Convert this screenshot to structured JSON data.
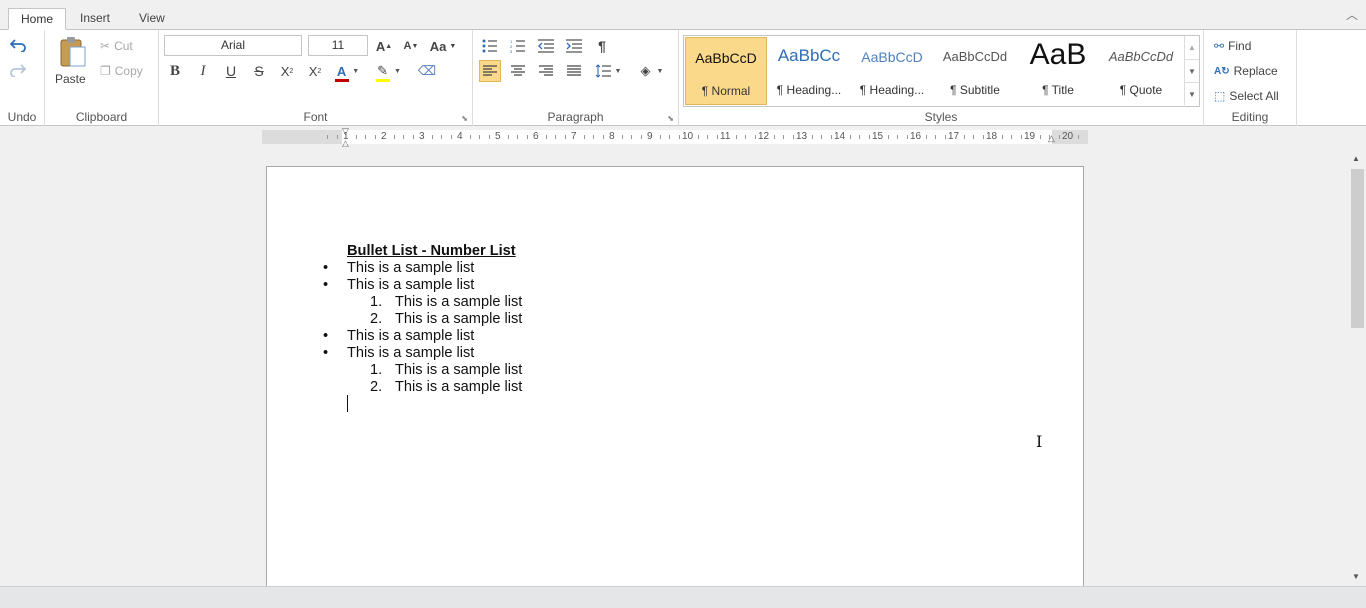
{
  "tabs": [
    "Home",
    "Insert",
    "View"
  ],
  "active_tab": "Home",
  "collapse_icon": "chevron-up-icon",
  "groups": {
    "undo": "Undo",
    "clipboard": "Clipboard",
    "font": "Font",
    "paragraph": "Paragraph",
    "styles": "Styles",
    "editing": "Editing"
  },
  "clipboard": {
    "paste": "Paste",
    "cut": "Cut",
    "copy": "Copy"
  },
  "font": {
    "name": "Arial",
    "size": "11"
  },
  "styles": [
    {
      "sample": "AaBbCcD",
      "name": "¶ Normal",
      "selected": true
    },
    {
      "sample": "AaBbCc",
      "name": "¶ Heading..."
    },
    {
      "sample": "AaBbCcD",
      "name": "¶ Heading..."
    },
    {
      "sample": "AaBbCcDd",
      "name": "¶ Subtitle"
    },
    {
      "sample": "AaB",
      "name": "¶ Title"
    },
    {
      "sample": "AaBbCcDd",
      "name": "¶ Quote"
    }
  ],
  "editing": {
    "find": "Find",
    "replace": "Replace",
    "select_all": "Select All"
  },
  "ruler_numbers": [
    "1",
    "2",
    "3",
    "4",
    "5",
    "6",
    "7",
    "8",
    "9",
    "10",
    "11",
    "12",
    "13",
    "14",
    "15",
    "16",
    "17",
    "18",
    "19",
    "20"
  ],
  "document": {
    "title": "Bullet List - Number List",
    "lines": [
      {
        "marker": "•",
        "text": "This is a sample list"
      },
      {
        "marker": "•",
        "text": "This is a sample list"
      },
      {
        "marker": "1.",
        "text": "This is a sample list"
      },
      {
        "marker": "2.",
        "text": "This is a sample list"
      },
      {
        "marker": "•",
        "text": "This is a sample list"
      },
      {
        "marker": "•",
        "text": "This is a sample list"
      },
      {
        "marker": "1.",
        "text": "This is a sample list"
      },
      {
        "marker": "2.",
        "text": "This is a sample list"
      }
    ]
  },
  "colors": {
    "accent_blue": "#2f6db5",
    "selected_style": "#fbd98b",
    "font_color_bar": "#c00000",
    "highlight_bar": "#ffff00"
  }
}
